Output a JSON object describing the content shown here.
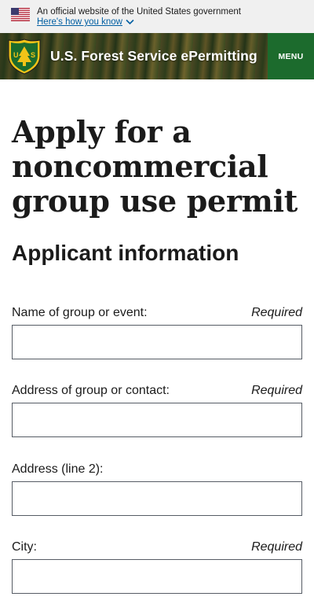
{
  "banner": {
    "text": "An official website of the United States government",
    "link": "Here's how you know"
  },
  "header": {
    "site_title": "U.S. Forest Service ePermitting",
    "menu_label": "MENU"
  },
  "main": {
    "page_title": "Apply for a noncommercial group use permit",
    "section_title": "Applicant information",
    "fields": [
      {
        "label": "Name of group or event:",
        "required": "Required",
        "value": ""
      },
      {
        "label": "Address of group or contact:",
        "required": "Required",
        "value": ""
      },
      {
        "label": "Address (line 2):",
        "required": "",
        "value": ""
      },
      {
        "label": "City:",
        "required": "Required",
        "value": ""
      }
    ]
  },
  "colors": {
    "banner_bg": "#f0f0f0",
    "link": "#005ea2",
    "menu_bg": "#1c6b2d",
    "text": "#1b1b1b"
  }
}
